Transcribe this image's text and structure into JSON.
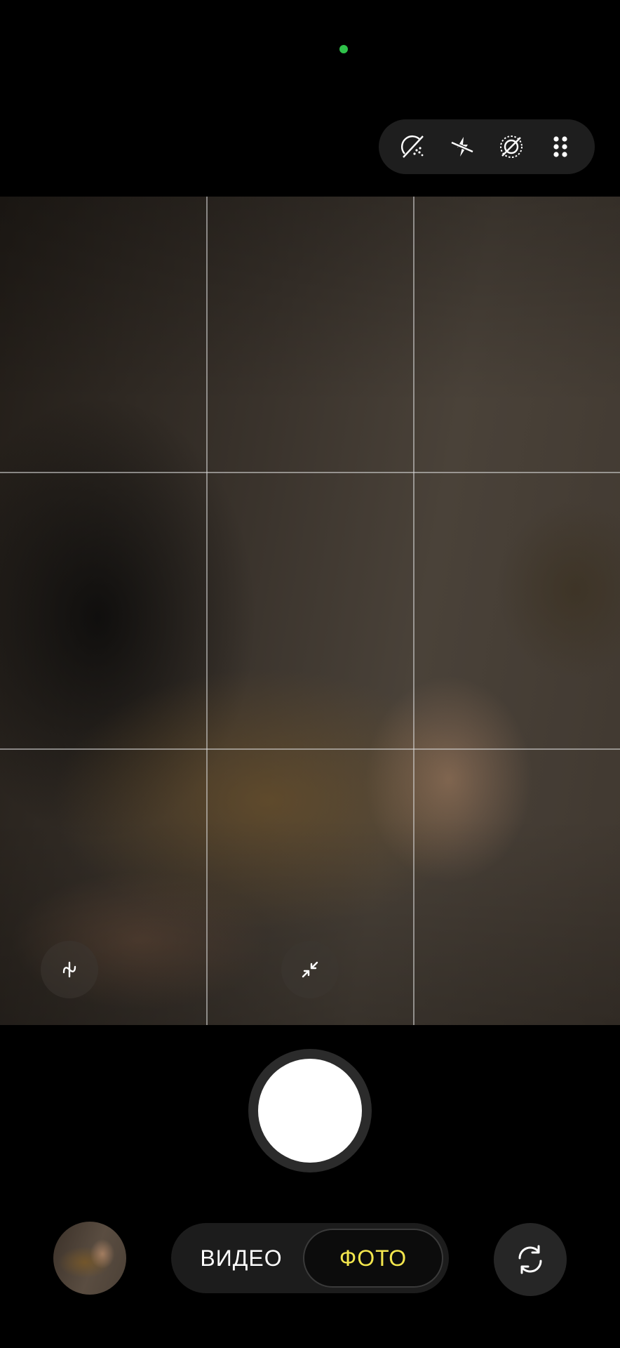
{
  "status": {
    "indicator_color": "#2fc24a"
  },
  "top_controls": [
    {
      "name": "filter-off",
      "icon": "magic-filter-off-icon"
    },
    {
      "name": "flash-off",
      "icon": "flash-off-icon"
    },
    {
      "name": "motion-photo-off",
      "icon": "motion-photo-off-icon"
    },
    {
      "name": "more",
      "icon": "grid-dots-icon"
    }
  ],
  "viewfinder": {
    "grid": "3x3",
    "left_control_icon": "stabilization-icon",
    "center_control_icon": "minimize-arrows-icon"
  },
  "bottom": {
    "modes": {
      "video_label": "ВИДЕО",
      "photo_label": "ФОТО",
      "selected": "photo"
    },
    "selected_color": "#f3e64d",
    "flip_icon": "switch-camera-icon"
  }
}
